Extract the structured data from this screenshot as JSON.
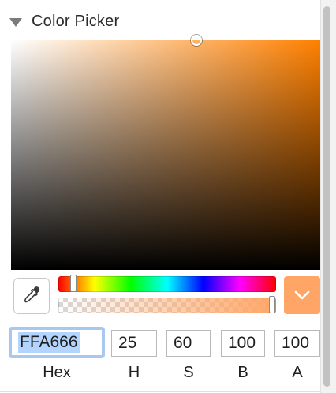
{
  "panel": {
    "title": "Color Picker",
    "disclosure_icon": "disclosure-triangle-down-icon"
  },
  "color": {
    "hex": "FFA666",
    "h": "25",
    "s": "60",
    "b": "100",
    "a": "100",
    "hue_color": "#ff8000",
    "swatch_color": "#ffa666",
    "saturation": 0.6,
    "brightness": 1.0,
    "hue_fraction": 0.07,
    "alpha_fraction": 1.0
  },
  "labels": {
    "hex": "Hex",
    "h": "H",
    "s": "S",
    "b": "B",
    "a": "A"
  },
  "icons": {
    "eyedropper": "eyedropper-icon",
    "swatch_dropdown": "chevron-down-icon"
  }
}
